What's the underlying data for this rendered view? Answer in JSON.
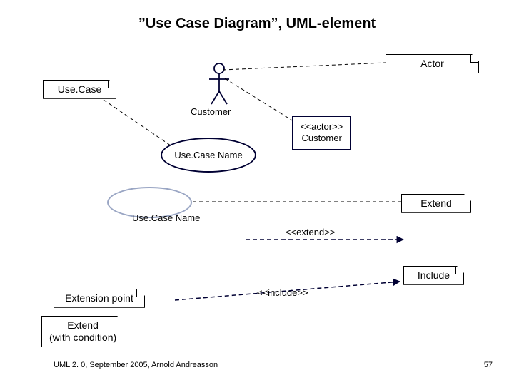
{
  "title": "”Use Case Diagram”, UML-element",
  "notes": {
    "actor": "Actor",
    "usecase": "Use.Case",
    "extend": "Extend",
    "include": "Include",
    "extension_point": "Extension point",
    "extend_condition_line1": "Extend",
    "extend_condition_line2": "(with condition)"
  },
  "usecases": {
    "top_primary": "Use.Case Name",
    "bottom_secondary": "Use.Case Name"
  },
  "actor_box": {
    "stereotype": "<<actor>>",
    "name": "Customer"
  },
  "stick_actor_label": "Customer",
  "relation_labels": {
    "extend": "<<extend>>",
    "include": "<<include>>"
  },
  "footer": "UML 2. 0, September 2005, Arnold Andreasson",
  "page": "57"
}
